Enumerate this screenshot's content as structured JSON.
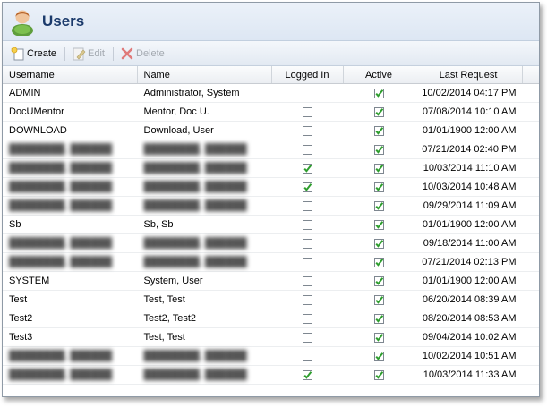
{
  "window": {
    "title": "Users"
  },
  "toolbar": {
    "create_label": "Create",
    "edit_label": "Edit",
    "delete_label": "Delete"
  },
  "columns": {
    "username": "Username",
    "name": "Name",
    "logged_in": "Logged In",
    "active": "Active",
    "last_request": "Last Request"
  },
  "rows": [
    {
      "username": "ADMIN",
      "name": "Administrator, System",
      "logged_in": false,
      "active": true,
      "last_request": "10/02/2014 04:17 PM",
      "redacted": false
    },
    {
      "username": "DocUMentor",
      "name": "Mentor, Doc U.",
      "logged_in": false,
      "active": true,
      "last_request": "07/08/2014 10:10 AM",
      "redacted": false
    },
    {
      "username": "DOWNLOAD",
      "name": "Download, User",
      "logged_in": false,
      "active": true,
      "last_request": "01/01/1900 12:00 AM",
      "redacted": false
    },
    {
      "username": "",
      "name": "",
      "logged_in": false,
      "active": true,
      "last_request": "07/21/2014 02:40 PM",
      "redacted": true
    },
    {
      "username": "",
      "name": "",
      "logged_in": true,
      "active": true,
      "last_request": "10/03/2014 11:10 AM",
      "redacted": true
    },
    {
      "username": "",
      "name": "",
      "logged_in": true,
      "active": true,
      "last_request": "10/03/2014 10:48 AM",
      "redacted": true
    },
    {
      "username": "",
      "name": "",
      "logged_in": false,
      "active": true,
      "last_request": "09/29/2014 11:09 AM",
      "redacted": true
    },
    {
      "username": "Sb",
      "name": "Sb, Sb",
      "logged_in": false,
      "active": true,
      "last_request": "01/01/1900 12:00 AM",
      "redacted": false
    },
    {
      "username": "",
      "name": "",
      "logged_in": false,
      "active": true,
      "last_request": "09/18/2014 11:00 AM",
      "redacted": true
    },
    {
      "username": "",
      "name": "",
      "logged_in": false,
      "active": true,
      "last_request": "07/21/2014 02:13 PM",
      "redacted": true
    },
    {
      "username": "SYSTEM",
      "name": "System, User",
      "logged_in": false,
      "active": true,
      "last_request": "01/01/1900 12:00 AM",
      "redacted": false
    },
    {
      "username": "Test",
      "name": "Test, Test",
      "logged_in": false,
      "active": true,
      "last_request": "06/20/2014 08:39 AM",
      "redacted": false
    },
    {
      "username": "Test2",
      "name": "Test2, Test2",
      "logged_in": false,
      "active": true,
      "last_request": "08/20/2014 08:53 AM",
      "redacted": false
    },
    {
      "username": "Test3",
      "name": "Test, Test",
      "logged_in": false,
      "active": true,
      "last_request": "09/04/2014 10:02 AM",
      "redacted": false
    },
    {
      "username": "",
      "name": "",
      "logged_in": false,
      "active": true,
      "last_request": "10/02/2014 10:51 AM",
      "redacted": true
    },
    {
      "username": "",
      "name": "",
      "logged_in": true,
      "active": true,
      "last_request": "10/03/2014 11:33 AM",
      "redacted": true
    }
  ],
  "colors": {
    "title_text": "#1b3a6b",
    "check_green": "#2e9e2e",
    "delete_red": "#d64040"
  },
  "icons": {
    "title": "user-icon",
    "create": "create-icon",
    "edit": "edit-icon",
    "delete": "delete-icon"
  }
}
